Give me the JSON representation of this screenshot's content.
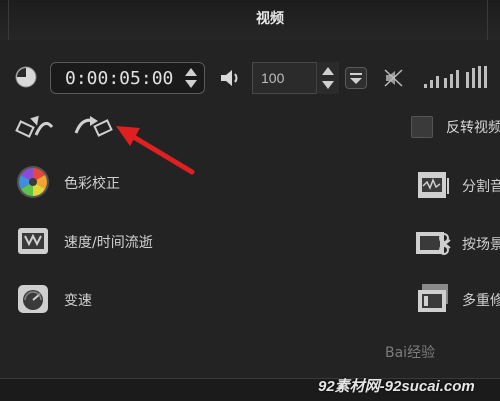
{
  "header": {
    "title": "视频"
  },
  "timecode": {
    "value": "0:00:05:00"
  },
  "volume": {
    "value": "100"
  },
  "reverse": {
    "label": "反转视频",
    "checked": false
  },
  "tools_left": [
    {
      "label": "色彩校正",
      "icon": "color-wheel-icon"
    },
    {
      "label": "速度/时间流逝",
      "icon": "film-speed-icon"
    },
    {
      "label": "变速",
      "icon": "speedometer-icon"
    }
  ],
  "tools_right": [
    {
      "label": "分割音",
      "icon": "split-audio-icon"
    },
    {
      "label": "按场景",
      "icon": "scene-split-icon"
    },
    {
      "label": "多重修",
      "icon": "multi-trim-icon"
    }
  ],
  "watermarks": {
    "baidu": "Bai经验",
    "site": "92素材网-92sucai.com"
  },
  "colors": {
    "annotation_arrow": "#e02020",
    "background": "#232323"
  }
}
